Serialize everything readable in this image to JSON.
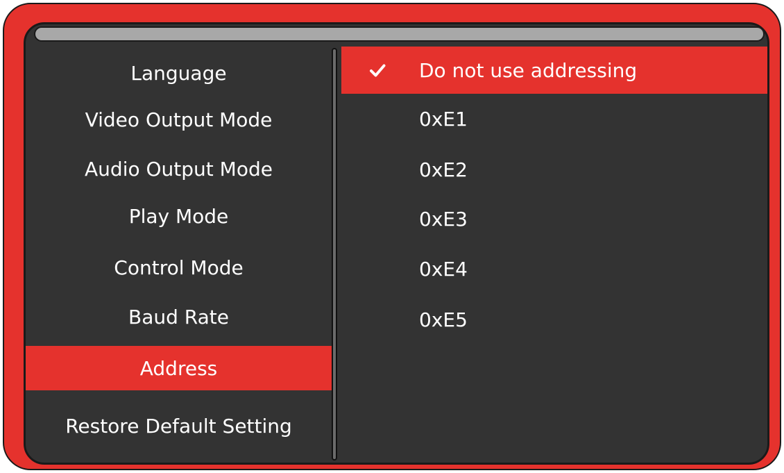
{
  "menu": {
    "items": [
      {
        "label": "Language"
      },
      {
        "label": "Video Output Mode"
      },
      {
        "label": "Audio Output Mode"
      },
      {
        "label": "Play Mode"
      },
      {
        "label": "Control Mode"
      },
      {
        "label": "Baud Rate"
      },
      {
        "label": "Address"
      },
      {
        "label": "Restore Default Setting"
      }
    ],
    "selected_label": "Address"
  },
  "address_options": {
    "items": [
      {
        "label": "Do not use addressing"
      },
      {
        "label": "0xE1"
      },
      {
        "label": "0xE2"
      },
      {
        "label": "0xE3"
      },
      {
        "label": "0xE4"
      },
      {
        "label": "0xE5"
      }
    ],
    "selected_label": "Do not use addressing",
    "selected_icon": "checkmark-icon"
  },
  "colors": {
    "accent": "#e5322d",
    "panel": "#333333",
    "text": "#ffffff"
  }
}
